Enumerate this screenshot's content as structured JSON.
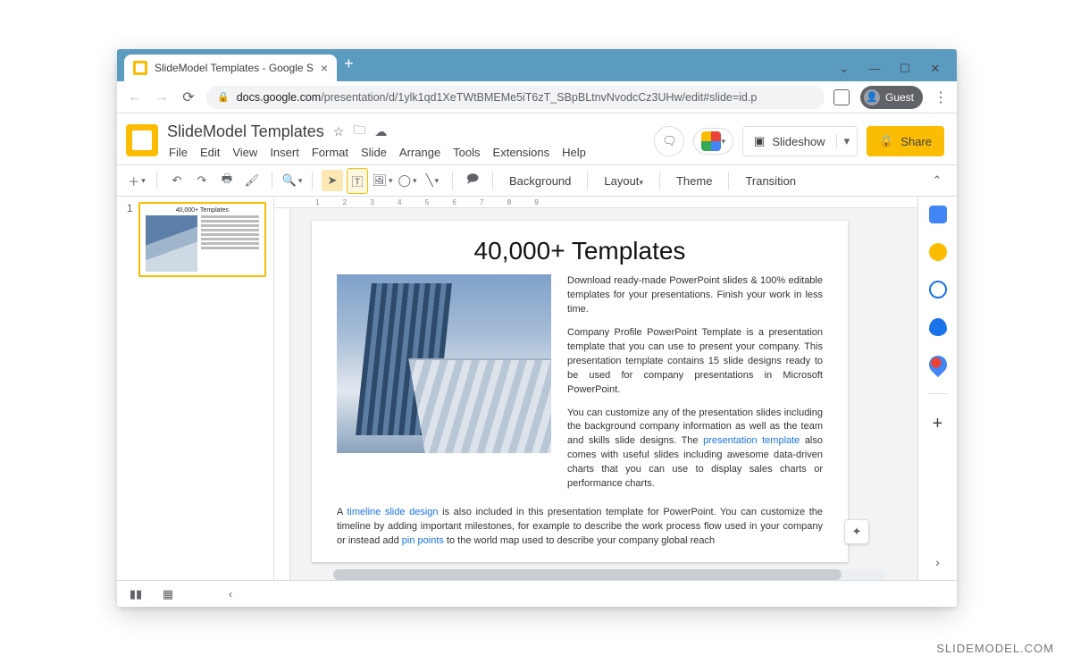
{
  "watermark": "SLIDEMODEL.COM",
  "browser": {
    "tab_title": "SlideModel Templates - Google S",
    "url_host": "docs.google.com",
    "url_path": "/presentation/d/1ylk1qd1XeTWtBMEMe5iT6zT_SBpBLtnvNvodcCz3UHw/edit#slide=id.p",
    "guest_label": "Guest"
  },
  "app": {
    "doc_title": "SlideModel Templates",
    "menus": [
      "File",
      "Edit",
      "View",
      "Insert",
      "Format",
      "Slide",
      "Arrange",
      "Tools",
      "Extensions",
      "Help"
    ],
    "slideshow_label": "Slideshow",
    "share_label": "Share"
  },
  "toolbar": {
    "background": "Background",
    "layout": "Layout",
    "theme": "Theme",
    "transition": "Transition"
  },
  "thumbnail": {
    "index": "1",
    "title": "40,000+ Templates"
  },
  "slide": {
    "title": "40,000+ Templates",
    "p1": "Download ready-made PowerPoint slides & 100% editable templates for your presentations. Finish your work in less time.",
    "p2": "Company Profile PowerPoint Template is a presentation template that you can use to present your company. This presentation template contains 15 slide designs ready to be used for company presentations in Microsoft PowerPoint.",
    "p3a": "You can customize any of the presentation slides including the background company information as well as the team and skills slide designs. The ",
    "p3_link": "presentation template",
    "p3b": " also comes with useful slides including awesome data-driven charts that you can use to display sales charts or performance charts.",
    "p4a": "A ",
    "p4_link1": "timeline slide design",
    "p4b": " is also included in this presentation template for PowerPoint. You can customize the timeline by adding important milestones, for example to describe the work process flow used in your company or instead add  ",
    "p4_link2": "pin points",
    "p4c": " to the world map used to describe your company global reach"
  }
}
